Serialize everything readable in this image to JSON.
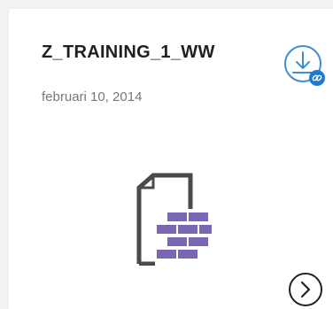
{
  "card": {
    "title": "Z_TRAINING_1_WW",
    "date": "februari 10, 2014"
  },
  "icons": {
    "download": "download-link-icon",
    "document": "document-brick-icon",
    "next": "chevron-right-circle-icon"
  },
  "colors": {
    "accent": "#3d8fd1",
    "badge": "#1f78d1",
    "brick": "#7a66b3",
    "doc_stroke": "#4a4a4a"
  }
}
